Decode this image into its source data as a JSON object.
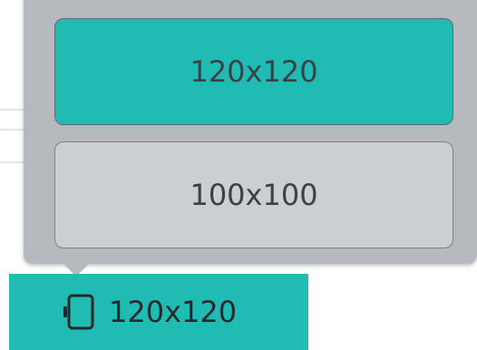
{
  "size_popup": {
    "options": [
      {
        "label": "120x120",
        "selected": true
      },
      {
        "label": "100x100",
        "selected": false
      }
    ]
  },
  "current_size": {
    "label": "120x120",
    "icon": "tablet-icon"
  },
  "colors": {
    "accent": "#20bcb4",
    "popup_bg": "#b6b9bd",
    "unselected_bg": "#cbced2",
    "text": "#3d4145"
  }
}
